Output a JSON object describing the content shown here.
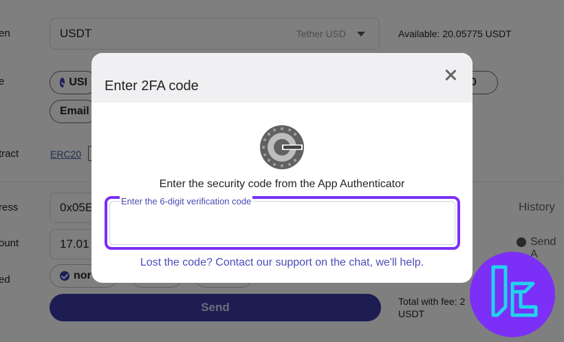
{
  "background": {
    "labels": [
      "en",
      "e",
      "tract",
      "ress",
      "ount",
      "ed"
    ],
    "token": {
      "value": "USDT",
      "name": "Tether USD",
      "available": "Available: 20.05775 USDT"
    },
    "network_chip_left": "USI",
    "network_chip_right": "20",
    "email_chip": "Email",
    "contract_link": "ERC20",
    "address_value": "0x05E",
    "history_label": "History",
    "amount_value": "17.01",
    "send_all_label": "Send A",
    "fee_chip": "nor",
    "send_button": "Send",
    "total_with_fee_line1": "Total with fee: 2",
    "total_with_fee_line2": "USDT"
  },
  "modal": {
    "title": "Enter 2FA code",
    "instruction": "Enter the security code from the App Authenticator",
    "code_legend": "Enter the 6-digit verification code",
    "code_value": "",
    "help_text": "Lost the code? Contact our support on the chat, we'll help."
  },
  "colors": {
    "accent": "#7b2ff7",
    "link": "#4b4bb8",
    "send_button": "#3a3aa8"
  },
  "icons": {
    "close": "close-icon",
    "authenticator": "google-authenticator-icon",
    "brand": "brand-logo-icon",
    "check": "check-icon"
  }
}
